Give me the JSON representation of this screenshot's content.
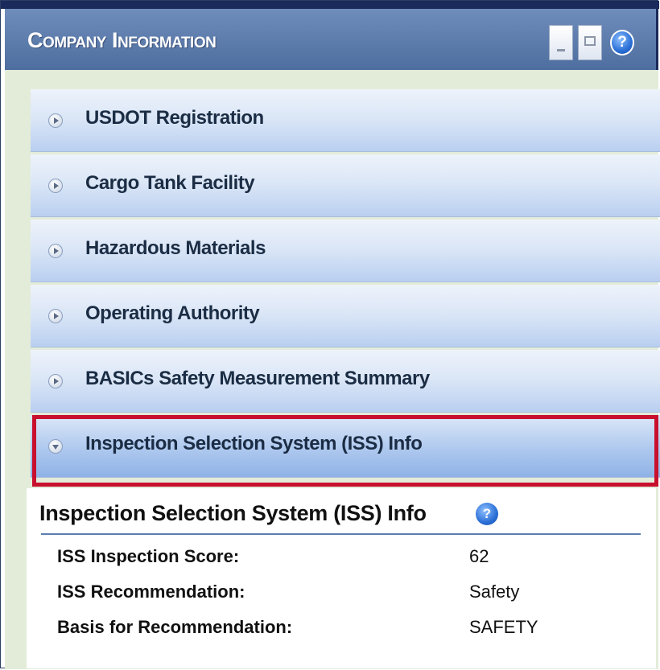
{
  "window": {
    "title": "Company Information",
    "help_symbol": "?"
  },
  "accordion": [
    {
      "label": "USDOT Registration",
      "expanded": false
    },
    {
      "label": "Cargo Tank Facility",
      "expanded": false
    },
    {
      "label": "Hazardous Materials",
      "expanded": false
    },
    {
      "label": "Operating Authority",
      "expanded": false
    },
    {
      "label": "BASICs Safety Measurement Summary",
      "expanded": false
    },
    {
      "label": "Inspection Selection System (ISS) Info",
      "expanded": true
    }
  ],
  "iss_panel": {
    "heading": "Inspection Selection System (ISS) Info",
    "help_symbol": "?",
    "rows": [
      {
        "key": "ISS Inspection Score:",
        "value": "62"
      },
      {
        "key": "ISS Recommendation:",
        "value": "Safety"
      },
      {
        "key": "Basis for Recommendation:",
        "value": "SAFETY"
      }
    ]
  },
  "colors": {
    "titlebar": "#5a7aab",
    "highlight": "#c8102e",
    "content_bg": "#e3ecd9"
  }
}
